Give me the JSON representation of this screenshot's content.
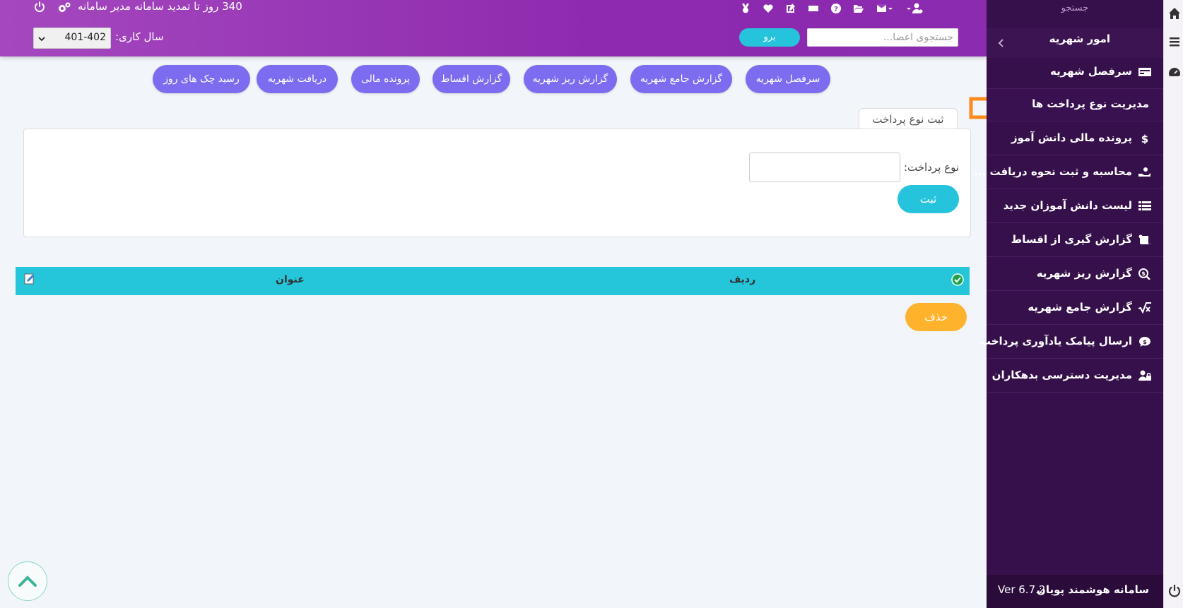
{
  "header": {
    "notice": "340 روز تا تمدید سامانه مدیر سامانه",
    "year_label": "سال کاری:",
    "year_value": "401-402",
    "search_placeholder": "جستجوی اعضا...",
    "go_label": "برو",
    "icons": [
      "user-gear-icon",
      "envelope-icon",
      "folder-open-icon",
      "help-icon",
      "ticket-icon",
      "edit-icon",
      "heartbeat-icon",
      "medal-icon"
    ]
  },
  "top_buttons": [
    {
      "label": "سرفصل شهریه"
    },
    {
      "label": "گزارش جامع شهریه"
    },
    {
      "label": "گزارش ریز شهریه"
    },
    {
      "label": "گزارش اقساط"
    },
    {
      "label": "پرونده مالی"
    },
    {
      "label": "دریافت شهریه"
    },
    {
      "label": "رسید چک های روز"
    }
  ],
  "form": {
    "tab_label": "ثبت نوع پرداخت",
    "field_label": "نوع پرداخت:",
    "field_value": "",
    "submit_label": "ثبت"
  },
  "table": {
    "headers": [
      "ردیف",
      "عنوان"
    ],
    "delete_label": "حذف"
  },
  "sidebar": {
    "search_label": "جستجو",
    "section_label": "امور شهریه",
    "items": [
      {
        "label": "سرفصل شهریه",
        "icon": "money-card-icon"
      },
      {
        "label": "مدیریت نوع پرداخت ها",
        "icon": "",
        "active": true
      },
      {
        "label": "پرونده مالی دانش آموز",
        "icon": "dollar-icon"
      },
      {
        "label": "محاسبه و ثبت نحوه دریافت ...",
        "icon": "hand-money-icon"
      },
      {
        "label": "لیست دانش آموزان جدید",
        "icon": "table-list-icon"
      },
      {
        "label": "گزارش گیری از اقساط",
        "icon": "scroll-icon"
      },
      {
        "label": "گزارش ریز شهریه",
        "icon": "search-dollar-icon"
      },
      {
        "label": "گزارش جامع شهریه",
        "icon": "square-root-icon"
      },
      {
        "label": "ارسال پیامک یادآوری پرداخت",
        "icon": "comment-dollar-icon"
      },
      {
        "label": "مدیریت دسترسی بدهکاران",
        "icon": "user-lock-icon"
      }
    ],
    "footer_name": "سامانه هوشمند پویان",
    "footer_version": "Ver 6.7.2"
  },
  "colors": {
    "header_start": "#a548bf",
    "header_end": "#8a2bb0",
    "sidebar_bg": "#36104a",
    "accent_cyan": "#26c4dc",
    "button_purple": "#7b6cf0",
    "delete_orange": "#ffb22b",
    "arrow_orange": "#ff8a1e"
  }
}
